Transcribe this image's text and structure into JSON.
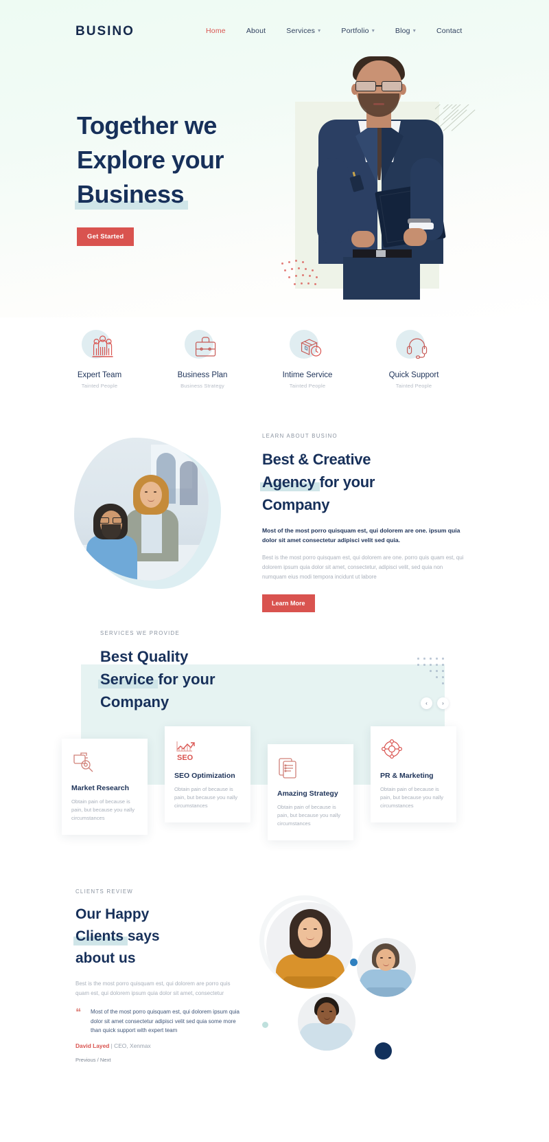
{
  "brand": {
    "name": "BUSINO"
  },
  "nav": {
    "items": [
      {
        "label": "Home",
        "active": true,
        "caret": false
      },
      {
        "label": "About",
        "active": false,
        "caret": false
      },
      {
        "label": "Services",
        "active": false,
        "caret": true
      },
      {
        "label": "Portfolio",
        "active": false,
        "caret": true
      },
      {
        "label": "Blog",
        "active": false,
        "caret": true
      },
      {
        "label": "Contact",
        "active": false,
        "caret": false
      }
    ]
  },
  "hero": {
    "line1": "Together we",
    "line2": "Explore your",
    "line3_highlight": "Business",
    "cta": "Get Started"
  },
  "features": [
    {
      "title": "Expert Team",
      "sub": "Tainted People",
      "icon": "people-group-icon"
    },
    {
      "title": "Business Plan",
      "sub": "Business Strategy",
      "icon": "briefcase-icon"
    },
    {
      "title": "Intime Service",
      "sub": "Tainted People",
      "icon": "box-clock-icon"
    },
    {
      "title": "Quick Support",
      "sub": "Tainted People",
      "icon": "headset-icon"
    }
  ],
  "about": {
    "eyebrow": "LEARN ABOUT BUSINO",
    "title_a": "Best & Creative",
    "title_highlight": "Agency",
    "title_b": " for your",
    "title_c": "Company",
    "lead": "Most of the most porro quisquam est, qui dolorem are one. ipsum quia dolor sit amet consectetur adipisci velit sed quia.",
    "body": "Best is the most porro quisquam est, qui dolorem are one. porro quis quam est, qui dolorem ipsum quia dolor sit amet, consectetur, adipisci velit, sed quia non numquam eius modi tempora incidunt ut labore",
    "cta": "Learn More"
  },
  "services": {
    "eyebrow": "SERVICES WE PROVIDE",
    "title_a": "Best Quality",
    "title_highlight": "Service",
    "title_b": " for your",
    "title_c": "Company",
    "prev_arrow": "‹",
    "next_arrow": "›",
    "cards": [
      {
        "name": "Market Research",
        "desc": "Obtain pain of because is pain, but because you nally circumstances",
        "icon": "market-research-icon"
      },
      {
        "name": "SEO Optimization",
        "desc": "Obtain pain of because is pain, but because you nally circumstances",
        "icon": "seo-icon"
      },
      {
        "name": "Amazing Strategy",
        "desc": "Obtain pain of because is pain, but because you nally circumstances",
        "icon": "strategy-document-icon"
      },
      {
        "name": "PR & Marketing",
        "desc": "Obtain pain of because is pain, but because you nally circumstances",
        "icon": "pr-marketing-icon"
      }
    ]
  },
  "testimonials": {
    "eyebrow": "CLIENTS REVIEW",
    "title_a": "Our Happy",
    "title_highlight": "Clients",
    "title_b": " says",
    "title_c": "about us",
    "body": "Best is the most porro quisquam est, qui dolorem are porro quis quam est, qui dolorem ipsum quia dolor sit amet, consectetur",
    "quote_mark": "❝",
    "quote": "Most of the most porro quisquam est, qui dolorem ipsum quia dolor sit amet consectetur adipisci velit sed quia some more than quick support with expert team",
    "author_name": "David Layed",
    "author_role": "| CEO, Xenmax",
    "prev": "Previous",
    "sep": "/",
    "next": "Next"
  },
  "colors": {
    "accent_red": "#d9534f",
    "navy": "#17305a",
    "highlight": "#cfe5e8",
    "panel_teal": "#e6f3f2",
    "hero_bg": "#eefbf3"
  }
}
